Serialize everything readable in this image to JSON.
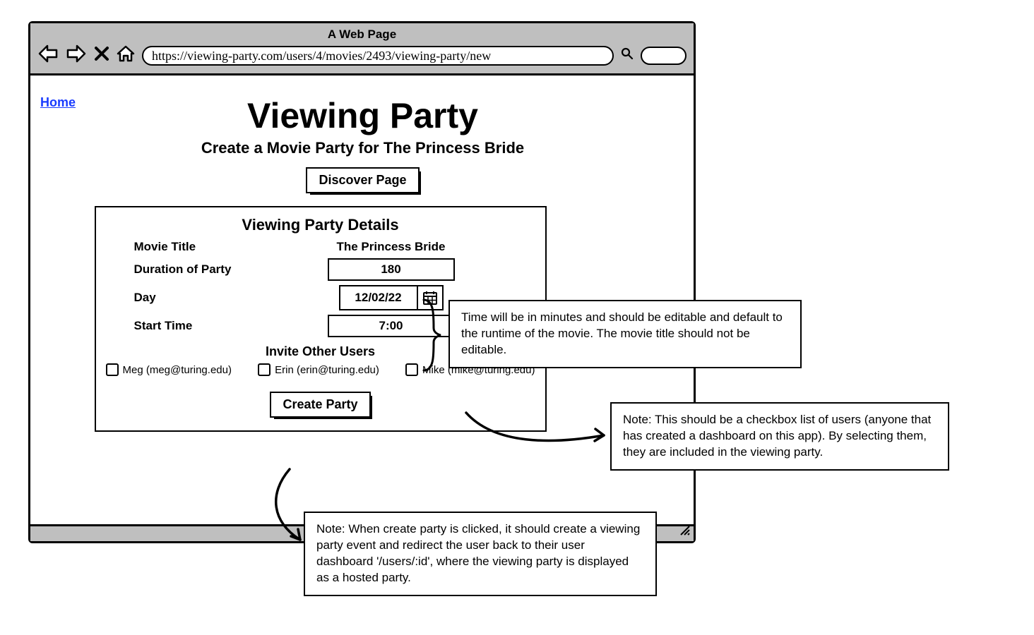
{
  "browser": {
    "chrome_title": "A Web Page",
    "url": "https://viewing-party.com/users/4/movies/2493/viewing-party/new"
  },
  "nav": {
    "home_link": "Home"
  },
  "header": {
    "title": "Viewing Party",
    "subtitle": "Create a Movie Party for The Princess Bride",
    "discover_btn": "Discover Page"
  },
  "details": {
    "panel_title": "Viewing Party Details",
    "labels": {
      "movie_title": "Movie Title",
      "duration": "Duration of Party",
      "day": "Day",
      "start_time": "Start Time"
    },
    "values": {
      "movie_title": "The Princess Bride",
      "duration": "180",
      "day": "12/02/22",
      "start_time": "7:00"
    },
    "invite_title": "Invite Other Users",
    "invitees": [
      {
        "label": "Meg (meg@turing.edu)"
      },
      {
        "label": "Erin (erin@turing.edu)"
      },
      {
        "label": "Mike (mike@turing.edu)"
      }
    ],
    "create_btn": "Create Party"
  },
  "annotations": {
    "time": "Time will be in minutes and should be editable and default to the runtime of the movie. The movie title should not be editable.",
    "users": "Note: This should be a checkbox list of users (anyone that has created a dashboard on this app). By selecting them, they are included in the viewing party.",
    "create": "Note: When create party is clicked, it should create a viewing party event and redirect the user back to their user dashboard '/users/:id', where the viewing party is displayed as a hosted party."
  }
}
